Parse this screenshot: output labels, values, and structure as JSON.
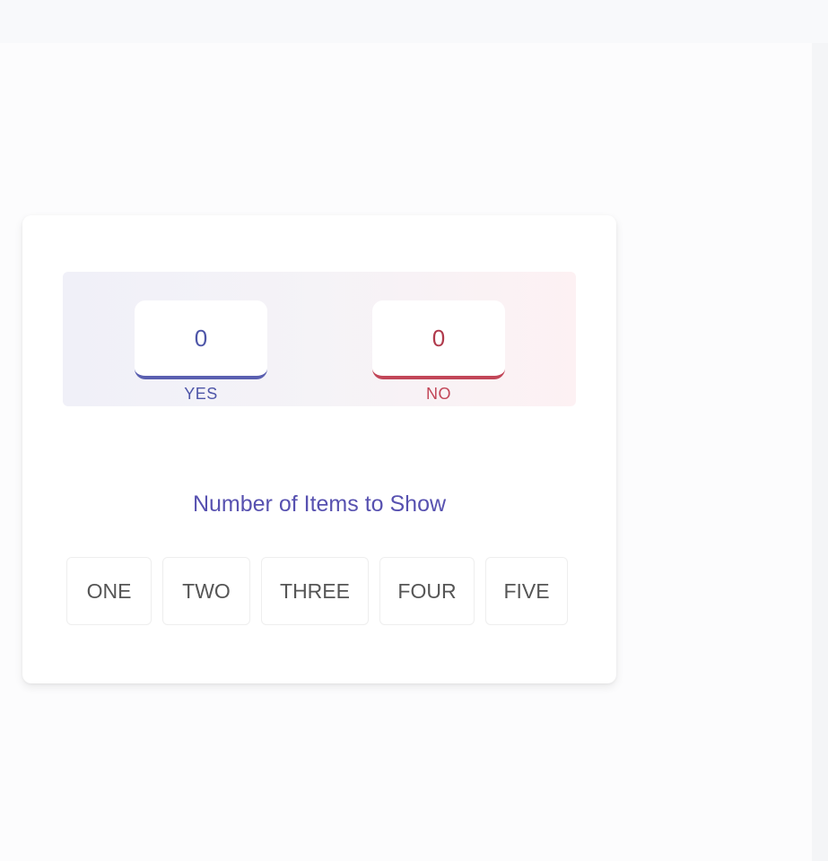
{
  "poll": {
    "yes": {
      "count": "0",
      "label": "YES"
    },
    "no": {
      "count": "0",
      "label": "NO"
    }
  },
  "items_section": {
    "title": "Number of Items to Show",
    "options": [
      "ONE",
      "TWO",
      "THREE",
      "FOUR",
      "FIVE"
    ]
  },
  "colors": {
    "yes_accent": "#5a5fb0",
    "no_accent": "#c24658",
    "title": "#5751b0"
  }
}
